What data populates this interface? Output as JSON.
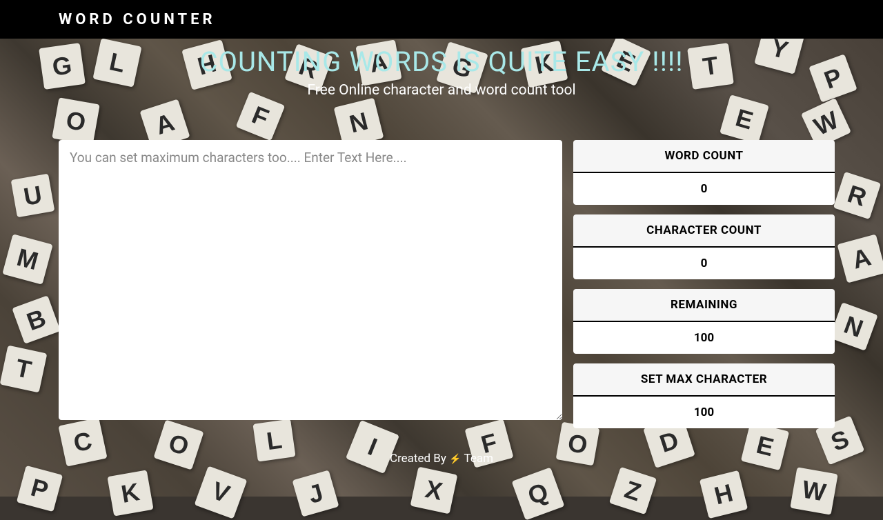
{
  "header": {
    "title": "WORD COUNTER"
  },
  "hero": {
    "title": "COUNTING WORDS IS QUITE EASY !!!!",
    "subtitle": "Free Online character and word count tool"
  },
  "input": {
    "placeholder": "You can set maximum characters too.... Enter Text Here....",
    "value": ""
  },
  "stats": {
    "word_count": {
      "label": "WORD COUNT",
      "value": "0"
    },
    "char_count": {
      "label": "CHARACTER COUNT",
      "value": "0"
    },
    "remaining": {
      "label": "REMAINING",
      "value": "100"
    },
    "max_char": {
      "label": "SET MAX CHARACTER",
      "value": "100"
    }
  },
  "footer": {
    "prefix": "Created By ",
    "suffix": " Team"
  }
}
